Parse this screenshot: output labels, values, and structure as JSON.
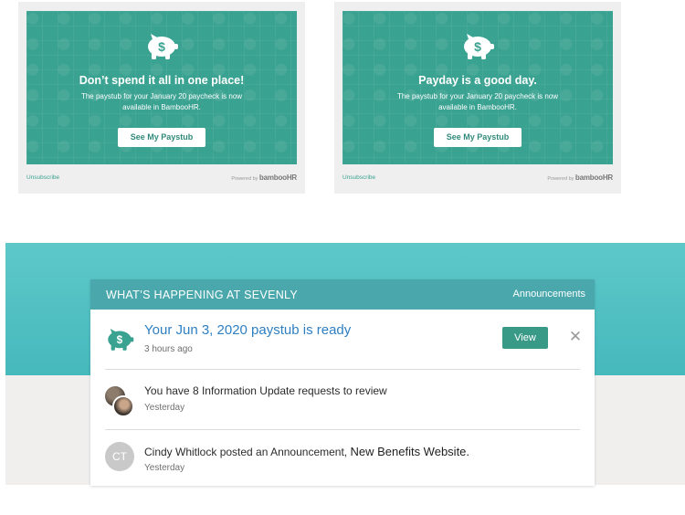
{
  "emails": [
    {
      "headline": "Don’t spend it all in one place!",
      "body_line1": "The paystub for your January 20 paycheck is now",
      "body_line2": "available in BambooHR.",
      "button_label": "See My Paystub",
      "unsubscribe_label": "Unsubscribe",
      "powered_label": "Powered by",
      "brand_label": "bambooHR"
    },
    {
      "headline": "Payday is a good day.",
      "body_line1": "The paystub for your January 20 paycheck is now",
      "body_line2": "available in BambooHR.",
      "button_label": "See My Paystub",
      "unsubscribe_label": "Unsubscribe",
      "powered_label": "Powered by",
      "brand_label": "bambooHR"
    }
  ],
  "dashboard": {
    "header_title": "WHAT’S HAPPENING AT SEVENLY",
    "header_link": "Announcements",
    "feed": [
      {
        "title": "Your Jun 3, 2020 paystub is ready",
        "time": "3 hours ago",
        "action_label": "View",
        "close_glyph": "✕",
        "icon": "piggy-bank-icon"
      },
      {
        "text": "You have 8 Information Update requests to review",
        "time": "Yesterday",
        "icon": "user-avatars"
      },
      {
        "text": "Cindy Whitlock posted an Announcement,",
        "link": "New Benefits Website.",
        "time": "Yesterday",
        "initials": "CT"
      }
    ]
  },
  "colors": {
    "email_teal": "#3aa291",
    "band_teal": "#4aa8ad",
    "view_button": "#3a9a88",
    "link_blue": "#2f7fc1"
  }
}
